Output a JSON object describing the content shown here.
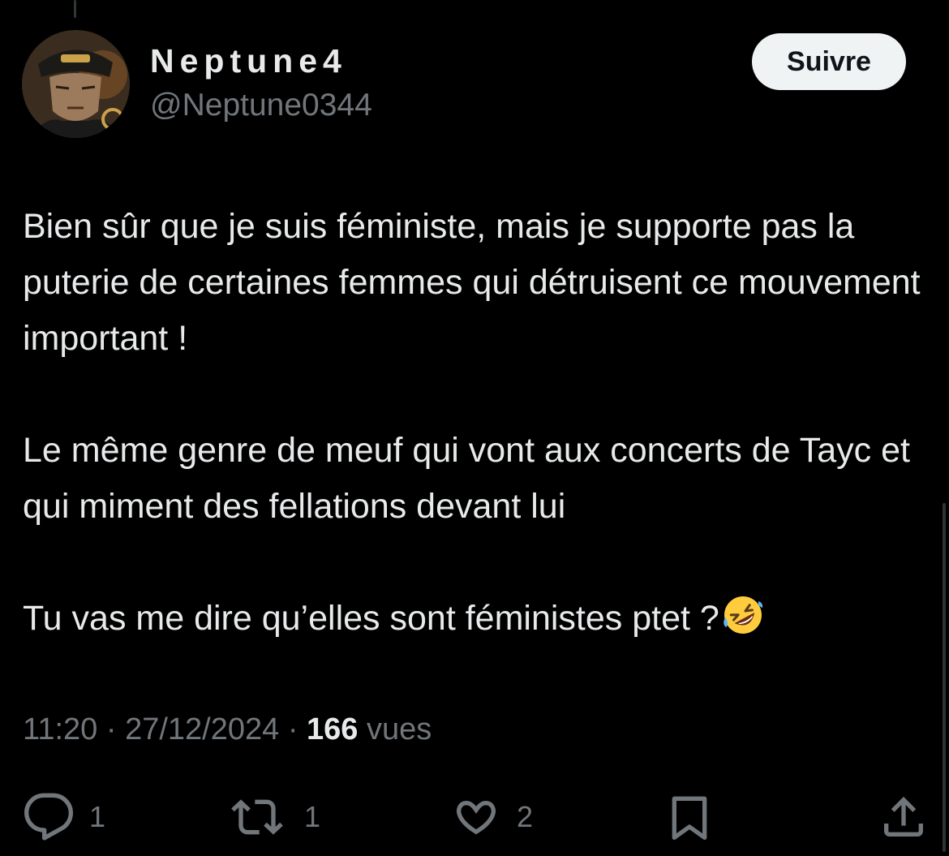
{
  "author": {
    "display_name": "Neptune4",
    "handle": "@Neptune0344",
    "avatar_icon": "anime-character-avatar"
  },
  "follow_button": {
    "label": "Suivre"
  },
  "tweet": {
    "paragraphs": [
      "Bien sûr que je suis féministe, mais je supporte pas la puterie de certaines femmes qui détruisent ce mouvement important !",
      "Le même genre de meuf qui vont aux concerts de Tayc et qui miment des fellations devant lui",
      "Tu vas me dire qu’elles sont féministes ptet ?"
    ],
    "emoji_icon": "rolling-on-floor-laughing-emoji"
  },
  "meta": {
    "time": "11:20",
    "separator": "·",
    "date": "27/12/2024",
    "views_count": "166",
    "views_label": "vues"
  },
  "actions": {
    "reply_count": "1",
    "retweet_count": "1",
    "like_count": "2"
  },
  "colors": {
    "background": "#000000",
    "text_primary": "#e7e9ea",
    "text_secondary": "#71767b",
    "button_bg": "#eff3f4"
  }
}
